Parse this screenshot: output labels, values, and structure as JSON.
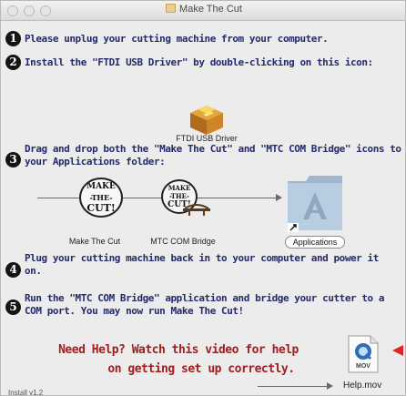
{
  "window": {
    "title": "Make The Cut"
  },
  "steps": [
    {
      "number": "1",
      "text": "Please unplug your cutting machine from your computer."
    },
    {
      "number": "2",
      "text": "Install the \"FTDI USB Driver\" by double-clicking on this icon:"
    },
    {
      "number": "3",
      "text": "Drag and drop both the \"Make The Cut\" and \"MTC COM Bridge\" icons to your Applications folder:"
    },
    {
      "number": "4",
      "text": "Plug your cutting machine back in to your computer and power it on."
    },
    {
      "number": "5",
      "text": "Run the \"MTC COM Bridge\" application and bridge your cutter to a COM port. You may now run Make The Cut!"
    }
  ],
  "icons": {
    "ftdi_driver": {
      "label": "FTDI USB Driver",
      "icon": "package-icon"
    },
    "make_the_cut": {
      "label": "Make The Cut",
      "icon": "make-the-cut-app-icon",
      "badge_top": "MAKE",
      "badge_mid": "-THE-",
      "badge_bottom": "CUT!"
    },
    "com_bridge": {
      "label": "MTC COM Bridge",
      "icon": "com-bridge-app-icon",
      "badge_top": "MAKE",
      "badge_mid": "-THE-",
      "badge_bottom": "CUT!"
    },
    "applications": {
      "label": "Applications",
      "icon": "applications-folder-icon"
    },
    "help_video": {
      "label": "Help.mov",
      "icon": "quicktime-movie-icon",
      "badge": "MOV"
    }
  },
  "help": {
    "line1": "Need Help? Watch this video for help",
    "line2": "on getting set up correctly."
  },
  "footer": {
    "version": "Install v1.2"
  },
  "colors": {
    "step_text": "#252a6a",
    "help_text": "#a11e1e",
    "pointer_arrow": "#e02424"
  }
}
